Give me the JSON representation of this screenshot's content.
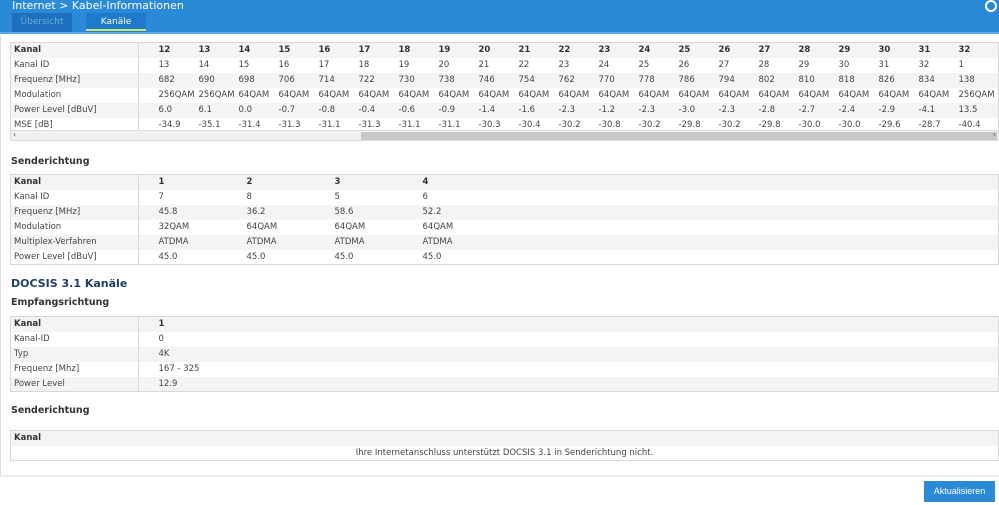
{
  "header": {
    "title": "Internet > Kabel-Informationen",
    "tabs": [
      "Übersicht",
      "Kanäle"
    ]
  },
  "down30": {
    "labels": [
      "Kanal",
      "Kanal ID",
      "Frequenz [MHz]",
      "Modulation",
      "Power Level [dBuV]",
      "MSE [dB]"
    ],
    "columns": [
      [
        "12",
        "13",
        "682",
        "256QAM",
        "6.0",
        "-34.9"
      ],
      [
        "13",
        "14",
        "690",
        "256QAM",
        "6.1",
        "-35.1"
      ],
      [
        "14",
        "15",
        "698",
        "64QAM",
        "0.0",
        "-31.4"
      ],
      [
        "15",
        "16",
        "706",
        "64QAM",
        "-0.7",
        "-31.3"
      ],
      [
        "16",
        "17",
        "714",
        "64QAM",
        "-0.8",
        "-31.1"
      ],
      [
        "17",
        "18",
        "722",
        "64QAM",
        "-0.4",
        "-31.3"
      ],
      [
        "18",
        "19",
        "730",
        "64QAM",
        "-0.6",
        "-31.1"
      ],
      [
        "19",
        "20",
        "738",
        "64QAM",
        "-0.9",
        "-31.1"
      ],
      [
        "20",
        "21",
        "746",
        "64QAM",
        "-1.4",
        "-30.3"
      ],
      [
        "21",
        "22",
        "754",
        "64QAM",
        "-1.6",
        "-30.4"
      ],
      [
        "22",
        "23",
        "762",
        "64QAM",
        "-2.3",
        "-30.2"
      ],
      [
        "23",
        "24",
        "770",
        "64QAM",
        "-1.2",
        "-30.8"
      ],
      [
        "24",
        "25",
        "778",
        "64QAM",
        "-2.3",
        "-30.2"
      ],
      [
        "25",
        "26",
        "786",
        "64QAM",
        "-3.0",
        "-29.8"
      ],
      [
        "26",
        "27",
        "794",
        "64QAM",
        "-2.3",
        "-30.2"
      ],
      [
        "27",
        "28",
        "802",
        "64QAM",
        "-2.8",
        "-29.8"
      ],
      [
        "28",
        "29",
        "810",
        "64QAM",
        "-2.7",
        "-30.0"
      ],
      [
        "29",
        "30",
        "818",
        "64QAM",
        "-2.4",
        "-30.0"
      ],
      [
        "30",
        "31",
        "826",
        "64QAM",
        "-2.9",
        "-29.6"
      ],
      [
        "31",
        "32",
        "834",
        "64QAM",
        "-4.1",
        "-28.7"
      ],
      [
        "32",
        "1",
        "138",
        "256QAM",
        "13.5",
        "-40.4"
      ]
    ]
  },
  "up30": {
    "title": "Senderichtung",
    "labels": [
      "Kanal",
      "Kanal ID",
      "Frequenz [MHz]",
      "Modulation",
      "Multiplex-Verfahren",
      "Power Level [dBuV]"
    ],
    "columns": [
      [
        "1",
        "7",
        "45.8",
        "32QAM",
        "ATDMA",
        "45.0"
      ],
      [
        "2",
        "8",
        "36.2",
        "64QAM",
        "ATDMA",
        "45.0"
      ],
      [
        "3",
        "5",
        "58.6",
        "64QAM",
        "ATDMA",
        "45.0"
      ],
      [
        "4",
        "6",
        "52.2",
        "64QAM",
        "ATDMA",
        "45.0"
      ]
    ]
  },
  "docsis31": {
    "title": "DOCSIS 3.1 Kanäle",
    "down": {
      "title": "Empfangsrichtung",
      "labels": [
        "Kanal",
        "Kanal-ID",
        "Typ",
        "Frequenz [Mhz]",
        "Power Level"
      ],
      "columns": [
        [
          "1",
          "0",
          "4K",
          "167 - 325",
          "12.9"
        ]
      ]
    },
    "up": {
      "title": "Senderichtung",
      "header": "Kanal",
      "message": "Ihre Internetanschluss unterstützt DOCSIS 3.1 in Senderichtung nicht."
    }
  },
  "button": "Aktualisieren"
}
